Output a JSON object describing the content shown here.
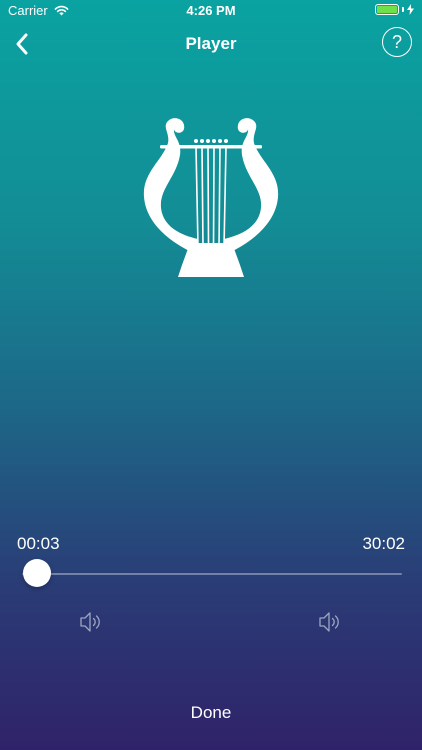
{
  "status_bar": {
    "carrier": "Carrier",
    "time": "4:26 PM",
    "icons": [
      "wifi-icon",
      "battery-icon",
      "charging-bolt-icon"
    ],
    "battery_color": "#6ee14a"
  },
  "nav": {
    "title": "Player",
    "back_icon": "chevron-left-icon",
    "help_label": "?"
  },
  "artwork": {
    "icon": "lyre-icon"
  },
  "player": {
    "current_time": "00:03",
    "total_time": "30:02",
    "progress": 0.0017,
    "volume_low_icon": "speaker-volume-icon",
    "volume_high_icon": "speaker-volume-icon"
  },
  "footer": {
    "done_label": "Done"
  },
  "colors": {
    "gradient_top": "#0aa3a1",
    "gradient_bottom": "#30226a",
    "text": "#ffffff"
  }
}
